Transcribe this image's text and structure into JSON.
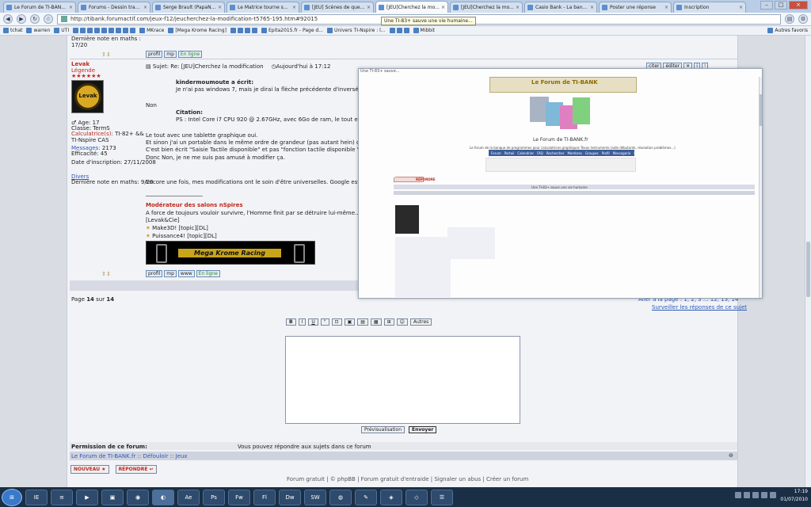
{
  "browser": {
    "tabs": [
      {
        "label": "Le Forum de TI-BAN...",
        "active": false
      },
      {
        "label": "Forums - Dessin tradi...",
        "active": false
      },
      {
        "label": "Serge Brault (PapaNi...",
        "active": false
      },
      {
        "label": "Le Matrice tourne so...",
        "active": false
      },
      {
        "label": "[JEU] Scènes de quel ...",
        "active": false
      },
      {
        "label": "[JEU]Cherchez la mo...",
        "active": true
      },
      {
        "label": "[JEU]Cherchez la mo...",
        "active": false
      },
      {
        "label": "Casio Bank - La banq...",
        "active": false
      },
      {
        "label": "Poster une réponse",
        "active": false
      },
      {
        "label": "Inscription",
        "active": false
      }
    ],
    "url": "http://tibank.forumactif.com/jeux-f12/jeucherchez-la-modification-t5765-195.htm#92015",
    "tooltip": "Une TI-83+ sauve une vie humaine...",
    "bookmarks": [
      "tchat",
      "warren",
      "UTI",
      "MKrace",
      "[Mega Krome Racing]",
      "Epita2015.fr - Page d...",
      "Univers TI-Nspire : l...",
      "Mibbit"
    ],
    "other_bookmarks": "Autres favoris"
  },
  "prev_post": {
    "last_note": "Dernière note en maths :",
    "note": "17/20"
  },
  "post": {
    "author": "Levak",
    "rank": "Légende",
    "stars": "★★★★★★",
    "avatar_text": "Levak",
    "subject": "Sujet: Re: [JEU]Cherchez la modification",
    "date": "Aujourd'hui à 17:12",
    "quote_author": "kindermoumoute a écrit:",
    "quote_text": "Je n'ai pas windows 7, mais je dirai la flèche précédente d'inversé avec la flèche suivante (ou un truc comme ça)",
    "reply_non": "Non",
    "citation_label": "Citation:",
    "citation_text": "PS : Intel Core i7 CPU 920 @ 2.67GHz, avec 6Go de ram, le tout en tablette tactile... ça existe?",
    "line1": "Le tout avec une tablette graphique oui.",
    "line2": "Et sinon j'ai un portable dans le même ordre de grandeur (pas autant hein) qui est tactile sous Win7",
    "line3": "C'est bien écrit \"Saisie Tactile disponible\" et pas \"fonction tactile disponible \"",
    "line4": "Donc Non, je ne me suis pas amusé à modifier ça.",
    "line5": "Encore une fois, mes modifications ont le soin d'être universelles. Google est ton ami",
    "sig_title": "Modérateur des salons nSpires",
    "sig_quote": "A force de toujours vouloir survivre, l'Homme finit par se détruire lui-même..(Levak)",
    "sig_team": "[Levak&Cie]",
    "sig_proj1": "Make3D! [topic][DL]",
    "sig_proj2": "Puissance4! [topic][DL]",
    "banner_text": "Mega Krome Racing",
    "info": {
      "age": "Age: 17",
      "classe": "Classe: TermS",
      "calcs_label": "Calculatrice(s):",
      "calcs_value": "TI-82+ && TI-Nspire CAS",
      "messages_label": "Messages:",
      "messages_value": "2173",
      "eff_label": "Efficacité:",
      "eff_value": "45",
      "inscr_label": "Date d'inscription:",
      "inscr_value": "27/11/2008",
      "divers": "Divers",
      "last_note": "Dernière note en maths: 9/20"
    },
    "buttons": {
      "profil": "profil",
      "mp": "mp",
      "www": "www",
      "online": "En ligne",
      "citer": "citer",
      "editer": "éditer"
    }
  },
  "page_nav": {
    "label": "Page",
    "current": "14",
    "sur": "sur",
    "total": "14",
    "goto": "Aller à la page :",
    "pages": "1, 2, 3 ... 12, 13, 14",
    "suivi": "Surveiller les réponses de ce sujet"
  },
  "editor": {
    "tools": [
      "B",
      "I",
      "U",
      "\"",
      "⊡",
      "▣",
      "▤",
      "▦",
      "⊞",
      "☺"
    ],
    "more": "Autres",
    "preview": "Prévisualisation",
    "send": "Envoyer"
  },
  "perm": {
    "label": "Permission de ce forum:",
    "text": "Vous pouvez répondre aux sujets dans ce forum"
  },
  "footer_nav": "Le Forum de TI-BANK.fr :: Défouloir :: Jeux",
  "actions": {
    "nouveau": "NOUVEAU",
    "repondre": "RÉPONDRE"
  },
  "footer_links": "Forum gratuit | © phpBB | Forum gratuit d'entraide | Signaler un abus | Créer un forum",
  "popup": {
    "tab": "Une TI-83+ sauve...",
    "brand": "Le Forum de TI-BANK",
    "subtitle": "Le Forum de TI-BANK.fr",
    "tagline": "Le forum de la banque de programmes pour calculatrices graphiques Texas Instruments (aide débutants, résolution problèmes...)",
    "nav": [
      "Forum",
      "Portail",
      "Calendrier",
      "FAQ",
      "Rechercher",
      "Membres",
      "Groupes",
      "Profil",
      "Messagerie",
      "Déconnexion"
    ],
    "topic": "Une TI-83+ sauve une vie humaine",
    "reply": "RÉPONDRE"
  },
  "taskbar": {
    "start": "⊞",
    "items": [
      "IE",
      "≡",
      "▶",
      "▣",
      "◉",
      "◐",
      "Ae",
      "Ps",
      "Fw",
      "Fl",
      "Dw",
      "SW",
      "◍",
      "✎",
      "◈",
      "◇",
      "☰"
    ],
    "time": "17:19",
    "date": "01/07/2010"
  }
}
